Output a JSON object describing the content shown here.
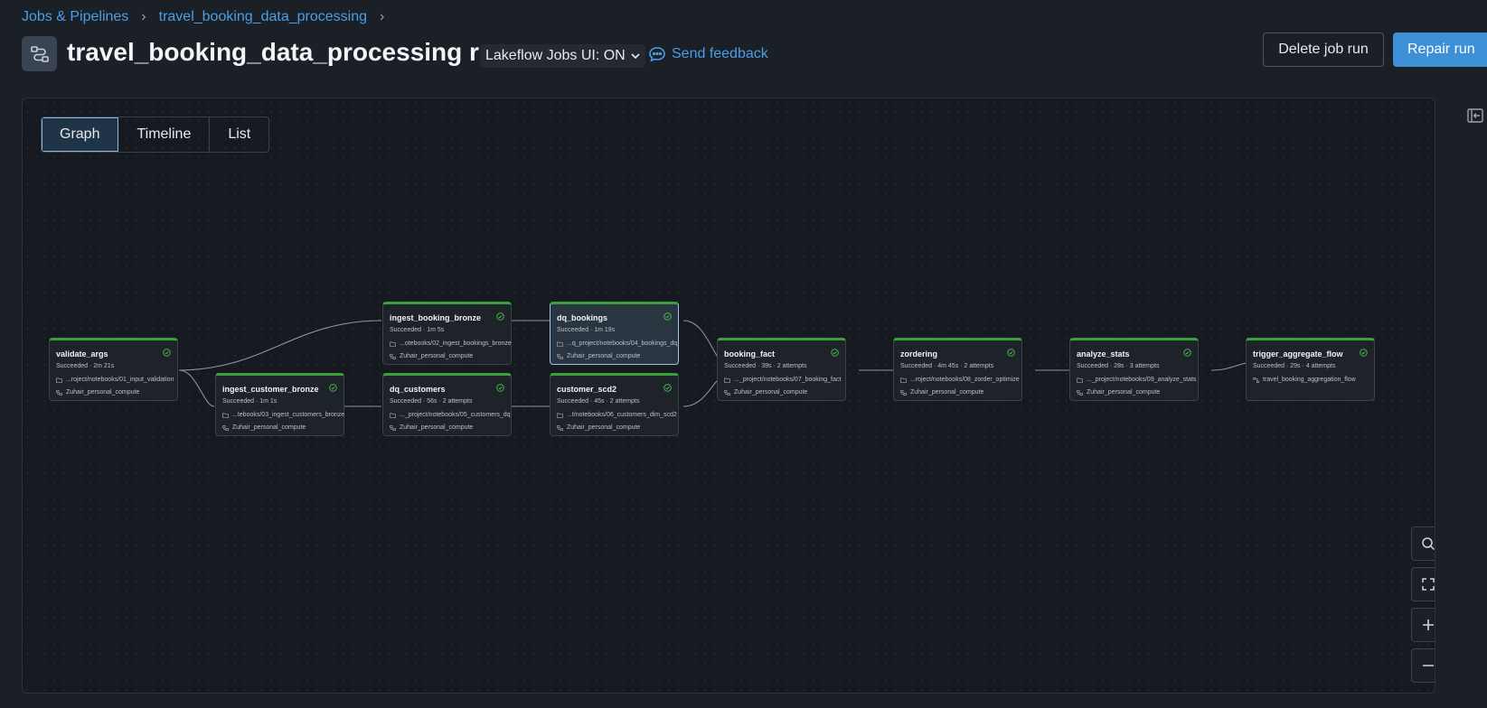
{
  "breadcrumb": [
    "Jobs & Pipelines",
    "travel_booking_data_processing"
  ],
  "title": "travel_booking_data_processing run",
  "ui_toggle": "Lakeflow Jobs UI: ON",
  "feedback": "Send feedback",
  "buttons": {
    "delete": "Delete job run",
    "repair": "Repair run"
  },
  "tabs": [
    "Graph",
    "Timeline",
    "List"
  ],
  "active_tab": "Graph",
  "colors": {
    "accent": "#4a9fe8",
    "success": "#3aa13a",
    "primary_button": "#3d8fd6"
  },
  "nodes": [
    {
      "name": "validate_args",
      "status": "Succeeded · 2m 21s",
      "path": "...roject/notebooks/01_input_validation",
      "compute": "Zuhair_personal_compute"
    },
    {
      "name": "ingest_booking_bronze",
      "status": "Succeeded · 1m 5s",
      "path": "...otebooks/02_ingest_bookings_bronze",
      "compute": "Zuhair_personal_compute"
    },
    {
      "name": "ingest_customer_bronze",
      "status": "Succeeded · 1m 1s",
      "path": "...tebooks/03_ingest_customers_bronze",
      "compute": "Zuhair_personal_compute"
    },
    {
      "name": "dq_bookings",
      "status": "Succeeded · 1m 19s",
      "path": "...q_project/notebooks/04_bookings_dq",
      "compute": "Zuhair_personal_compute"
    },
    {
      "name": "dq_customers",
      "status": "Succeeded · 56s · 2 attempts",
      "path": "..._project/notebooks/05_customers_dq",
      "compute": "Zuhair_personal_compute"
    },
    {
      "name": "customer_scd2",
      "status": "Succeeded · 45s · 2 attempts",
      "path": "...t/notebooks/06_customers_dim_scd2",
      "compute": "Zuhair_personal_compute"
    },
    {
      "name": "booking_fact",
      "status": "Succeeded · 39s · 2 attempts",
      "path": "..._project/notebooks/07_booking_fact",
      "compute": "Zuhair_personal_compute"
    },
    {
      "name": "zordering",
      "status": "Succeeded · 4m 45s · 2 attempts",
      "path": "...roject/notebooks/08_zorder_optimize",
      "compute": "Zuhair_personal_compute"
    },
    {
      "name": "analyze_stats",
      "status": "Succeeded · 28s · 3 attempts",
      "path": "..._project/notebooks/09_analyze_stats",
      "compute": "Zuhair_personal_compute"
    },
    {
      "name": "trigger_aggregate_flow",
      "status": "Succeeded · 29s · 4 attempts",
      "path": "travel_booking_aggregation_flow",
      "compute": ""
    }
  ],
  "icons": [
    "job-icon",
    "chevron-down-icon",
    "chat-icon",
    "sidebar-collapse-icon",
    "folder-icon",
    "compute-icon",
    "job-link-icon",
    "check-circle-icon",
    "search-icon",
    "fit-screen-icon",
    "zoom-in-icon",
    "zoom-out-icon"
  ]
}
